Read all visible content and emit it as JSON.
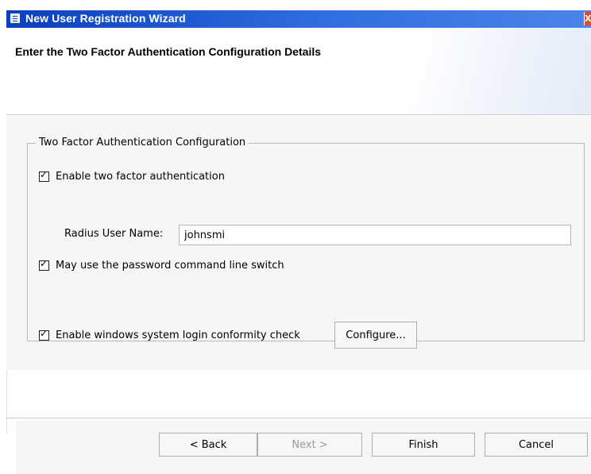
{
  "window": {
    "title": "New User Registration Wizard",
    "close_symbol": "X",
    "accent": "#0a3fbf"
  },
  "header": {
    "title": "Enter the Two Factor Authentication Configuration Details"
  },
  "group": {
    "legend": "Two Factor Authentication Configuration",
    "enable_2fa": {
      "label": "Enable two factor authentication",
      "checked": true
    },
    "radius_user": {
      "label": "Radius User Name:",
      "value": "johnsmi"
    },
    "password_switch": {
      "label": "May use the password command line switch",
      "checked": true
    },
    "login_conformity": {
      "label": "Enable windows system login conformity check",
      "checked": true
    },
    "configure_label": "Configure..."
  },
  "buttons": {
    "back": "< Back",
    "next": "Next >",
    "finish": "Finish",
    "cancel": "Cancel"
  },
  "check_glyph": "☑"
}
